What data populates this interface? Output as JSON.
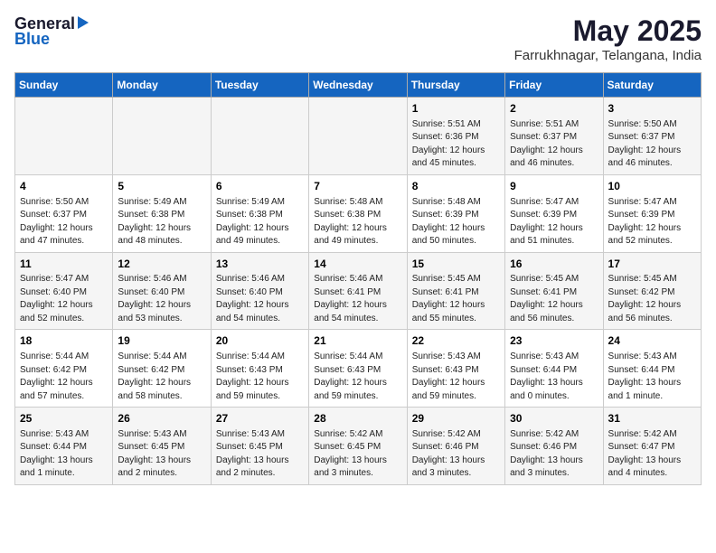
{
  "header": {
    "logo_general": "General",
    "logo_blue": "Blue",
    "title": "May 2025",
    "subtitle": "Farrukhnagar, Telangana, India"
  },
  "weekdays": [
    "Sunday",
    "Monday",
    "Tuesday",
    "Wednesday",
    "Thursday",
    "Friday",
    "Saturday"
  ],
  "weeks": [
    [
      {
        "day": "",
        "info": ""
      },
      {
        "day": "",
        "info": ""
      },
      {
        "day": "",
        "info": ""
      },
      {
        "day": "",
        "info": ""
      },
      {
        "day": "1",
        "info": "Sunrise: 5:51 AM\nSunset: 6:36 PM\nDaylight: 12 hours\nand 45 minutes."
      },
      {
        "day": "2",
        "info": "Sunrise: 5:51 AM\nSunset: 6:37 PM\nDaylight: 12 hours\nand 46 minutes."
      },
      {
        "day": "3",
        "info": "Sunrise: 5:50 AM\nSunset: 6:37 PM\nDaylight: 12 hours\nand 46 minutes."
      }
    ],
    [
      {
        "day": "4",
        "info": "Sunrise: 5:50 AM\nSunset: 6:37 PM\nDaylight: 12 hours\nand 47 minutes."
      },
      {
        "day": "5",
        "info": "Sunrise: 5:49 AM\nSunset: 6:38 PM\nDaylight: 12 hours\nand 48 minutes."
      },
      {
        "day": "6",
        "info": "Sunrise: 5:49 AM\nSunset: 6:38 PM\nDaylight: 12 hours\nand 49 minutes."
      },
      {
        "day": "7",
        "info": "Sunrise: 5:48 AM\nSunset: 6:38 PM\nDaylight: 12 hours\nand 49 minutes."
      },
      {
        "day": "8",
        "info": "Sunrise: 5:48 AM\nSunset: 6:39 PM\nDaylight: 12 hours\nand 50 minutes."
      },
      {
        "day": "9",
        "info": "Sunrise: 5:47 AM\nSunset: 6:39 PM\nDaylight: 12 hours\nand 51 minutes."
      },
      {
        "day": "10",
        "info": "Sunrise: 5:47 AM\nSunset: 6:39 PM\nDaylight: 12 hours\nand 52 minutes."
      }
    ],
    [
      {
        "day": "11",
        "info": "Sunrise: 5:47 AM\nSunset: 6:40 PM\nDaylight: 12 hours\nand 52 minutes."
      },
      {
        "day": "12",
        "info": "Sunrise: 5:46 AM\nSunset: 6:40 PM\nDaylight: 12 hours\nand 53 minutes."
      },
      {
        "day": "13",
        "info": "Sunrise: 5:46 AM\nSunset: 6:40 PM\nDaylight: 12 hours\nand 54 minutes."
      },
      {
        "day": "14",
        "info": "Sunrise: 5:46 AM\nSunset: 6:41 PM\nDaylight: 12 hours\nand 54 minutes."
      },
      {
        "day": "15",
        "info": "Sunrise: 5:45 AM\nSunset: 6:41 PM\nDaylight: 12 hours\nand 55 minutes."
      },
      {
        "day": "16",
        "info": "Sunrise: 5:45 AM\nSunset: 6:41 PM\nDaylight: 12 hours\nand 56 minutes."
      },
      {
        "day": "17",
        "info": "Sunrise: 5:45 AM\nSunset: 6:42 PM\nDaylight: 12 hours\nand 56 minutes."
      }
    ],
    [
      {
        "day": "18",
        "info": "Sunrise: 5:44 AM\nSunset: 6:42 PM\nDaylight: 12 hours\nand 57 minutes."
      },
      {
        "day": "19",
        "info": "Sunrise: 5:44 AM\nSunset: 6:42 PM\nDaylight: 12 hours\nand 58 minutes."
      },
      {
        "day": "20",
        "info": "Sunrise: 5:44 AM\nSunset: 6:43 PM\nDaylight: 12 hours\nand 59 minutes."
      },
      {
        "day": "21",
        "info": "Sunrise: 5:44 AM\nSunset: 6:43 PM\nDaylight: 12 hours\nand 59 minutes."
      },
      {
        "day": "22",
        "info": "Sunrise: 5:43 AM\nSunset: 6:43 PM\nDaylight: 12 hours\nand 59 minutes."
      },
      {
        "day": "23",
        "info": "Sunrise: 5:43 AM\nSunset: 6:44 PM\nDaylight: 13 hours\nand 0 minutes."
      },
      {
        "day": "24",
        "info": "Sunrise: 5:43 AM\nSunset: 6:44 PM\nDaylight: 13 hours\nand 1 minute."
      }
    ],
    [
      {
        "day": "25",
        "info": "Sunrise: 5:43 AM\nSunset: 6:44 PM\nDaylight: 13 hours\nand 1 minute."
      },
      {
        "day": "26",
        "info": "Sunrise: 5:43 AM\nSunset: 6:45 PM\nDaylight: 13 hours\nand 2 minutes."
      },
      {
        "day": "27",
        "info": "Sunrise: 5:43 AM\nSunset: 6:45 PM\nDaylight: 13 hours\nand 2 minutes."
      },
      {
        "day": "28",
        "info": "Sunrise: 5:42 AM\nSunset: 6:45 PM\nDaylight: 13 hours\nand 3 minutes."
      },
      {
        "day": "29",
        "info": "Sunrise: 5:42 AM\nSunset: 6:46 PM\nDaylight: 13 hours\nand 3 minutes."
      },
      {
        "day": "30",
        "info": "Sunrise: 5:42 AM\nSunset: 6:46 PM\nDaylight: 13 hours\nand 3 minutes."
      },
      {
        "day": "31",
        "info": "Sunrise: 5:42 AM\nSunset: 6:47 PM\nDaylight: 13 hours\nand 4 minutes."
      }
    ]
  ]
}
